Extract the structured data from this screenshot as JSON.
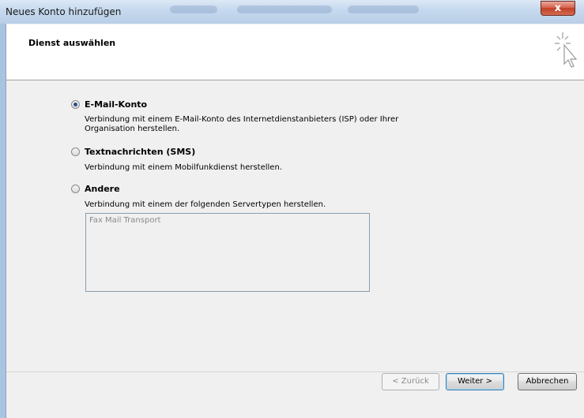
{
  "window": {
    "title": "Neues Konto hinzufügen",
    "close_label": "x"
  },
  "header": {
    "title": "Dienst auswählen",
    "icon": "cursor-click-sparkle-icon"
  },
  "options": [
    {
      "label": "E-Mail-Konto",
      "selected": true,
      "description_lines": [
        "Verbindung mit einem E-Mail-Konto des Internetdienstanbieters (ISP) oder Ihrer",
        "Organisation herstellen."
      ]
    },
    {
      "label": "Textnachrichten (SMS)",
      "selected": false,
      "description_lines": [
        "Verbindung mit einem Mobilfunkdienst herstellen."
      ]
    },
    {
      "label": "Andere",
      "selected": false,
      "description_lines": [
        "Verbindung mit einem der folgenden Servertypen herstellen."
      ]
    }
  ],
  "server_types": {
    "items": [
      "Fax Mail Transport"
    ]
  },
  "buttons": {
    "back": "< Zurück",
    "next": "Weiter >",
    "cancel": "Abbrechen"
  },
  "colors": {
    "titlebar": "#c5d8ee",
    "close_button": "#c1402a",
    "dialog_background": "#f0f0f0",
    "header_background": "#ffffff",
    "radio_selected_dot": "#2b4f8f"
  }
}
